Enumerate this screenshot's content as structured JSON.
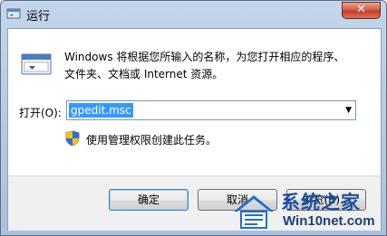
{
  "window": {
    "title": "运行",
    "close_label": "✕"
  },
  "description": {
    "line1": "Windows 将根据您所输入的名称，为您打开相应的程序、",
    "line2": "文件夹、文档或 Internet 资源。"
  },
  "open_field": {
    "label": "打开(O):",
    "value": "gpedit.msc"
  },
  "admin_note": "使用管理权限创建此任务。",
  "buttons": {
    "ok": "确定",
    "cancel": "取消",
    "browse": "浏览(B)..."
  },
  "watermark": {
    "brand": "系统之家",
    "url": "Win10net.com"
  }
}
